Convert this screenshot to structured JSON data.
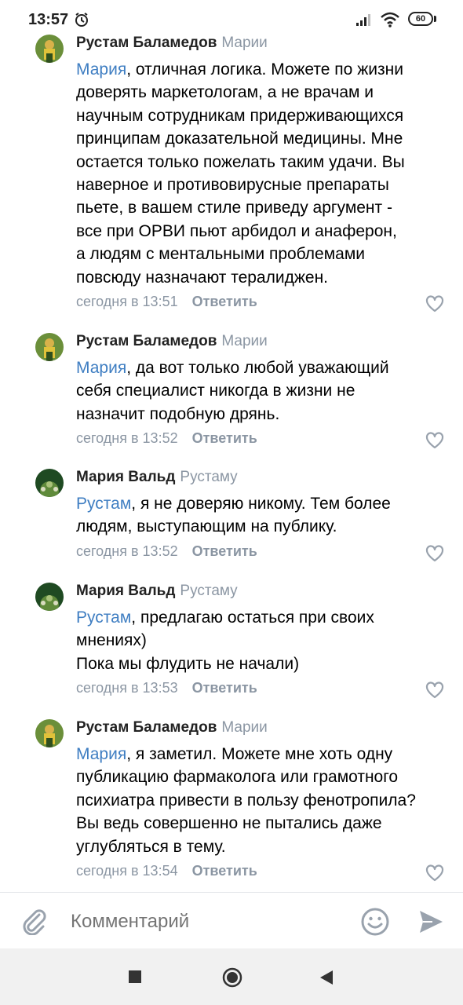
{
  "status_bar": {
    "time": "13:57",
    "battery": "60"
  },
  "composer": {
    "placeholder": "Комментарий"
  },
  "colors": {
    "mention": "#3f7ec2",
    "muted": "#8b96a3"
  },
  "comments": [
    {
      "author": "Рустам Баламедов",
      "reply_to": "Марии",
      "mention": "Мария",
      "lines": [
        ", отличная логика. Можете по жизни",
        "доверять маркетологам, а не врачам и",
        "научным сотрудникам придерживающихся",
        "принципам доказательной медицины. Мне",
        "остается только пожелать таким удачи. Вы",
        "наверное и противовирусные препараты",
        "пьете, в вашем стиле приведу аргумент -",
        "все при ОРВИ пьют арбидол и анаферон,",
        "а людям с ментальными проблемами",
        "повсюду назначают тералиджен."
      ],
      "time": "сегодня в 13:51",
      "reply_label": "Ответить"
    },
    {
      "author": "Рустам Баламедов",
      "reply_to": "Марии",
      "mention": "Мария",
      "lines": [
        ", да вот только любой уважающий",
        "себя специалист никогда в жизни не",
        "назначит подобную дрянь."
      ],
      "time": "сегодня в 13:52",
      "reply_label": "Ответить"
    },
    {
      "author": "Мария Вальд",
      "reply_to": "Рустаму",
      "mention": "Рустам",
      "lines": [
        ", я не доверяю никому. Тем более",
        "людям, выступающим на публику."
      ],
      "time": "сегодня в 13:52",
      "reply_label": "Ответить"
    },
    {
      "author": "Мария Вальд",
      "reply_to": "Рустаму",
      "mention": "Рустам",
      "lines": [
        ", предлагаю остаться при своих",
        "мнениях)",
        "Пока мы флудить не начали)"
      ],
      "time": "сегодня в 13:53",
      "reply_label": "Ответить"
    },
    {
      "author": "Рустам Баламедов",
      "reply_to": "Марии",
      "mention": "Мария",
      "lines": [
        ", я заметил. Можете мне хоть одну",
        "публикацию фармаколога или грамотного",
        "психиатра привести в пользу фенотропила?",
        "Вы ведь совершенно не пытались даже",
        "углубляться в тему."
      ],
      "time": "сегодня в 13:54",
      "reply_label": "Ответить"
    }
  ]
}
